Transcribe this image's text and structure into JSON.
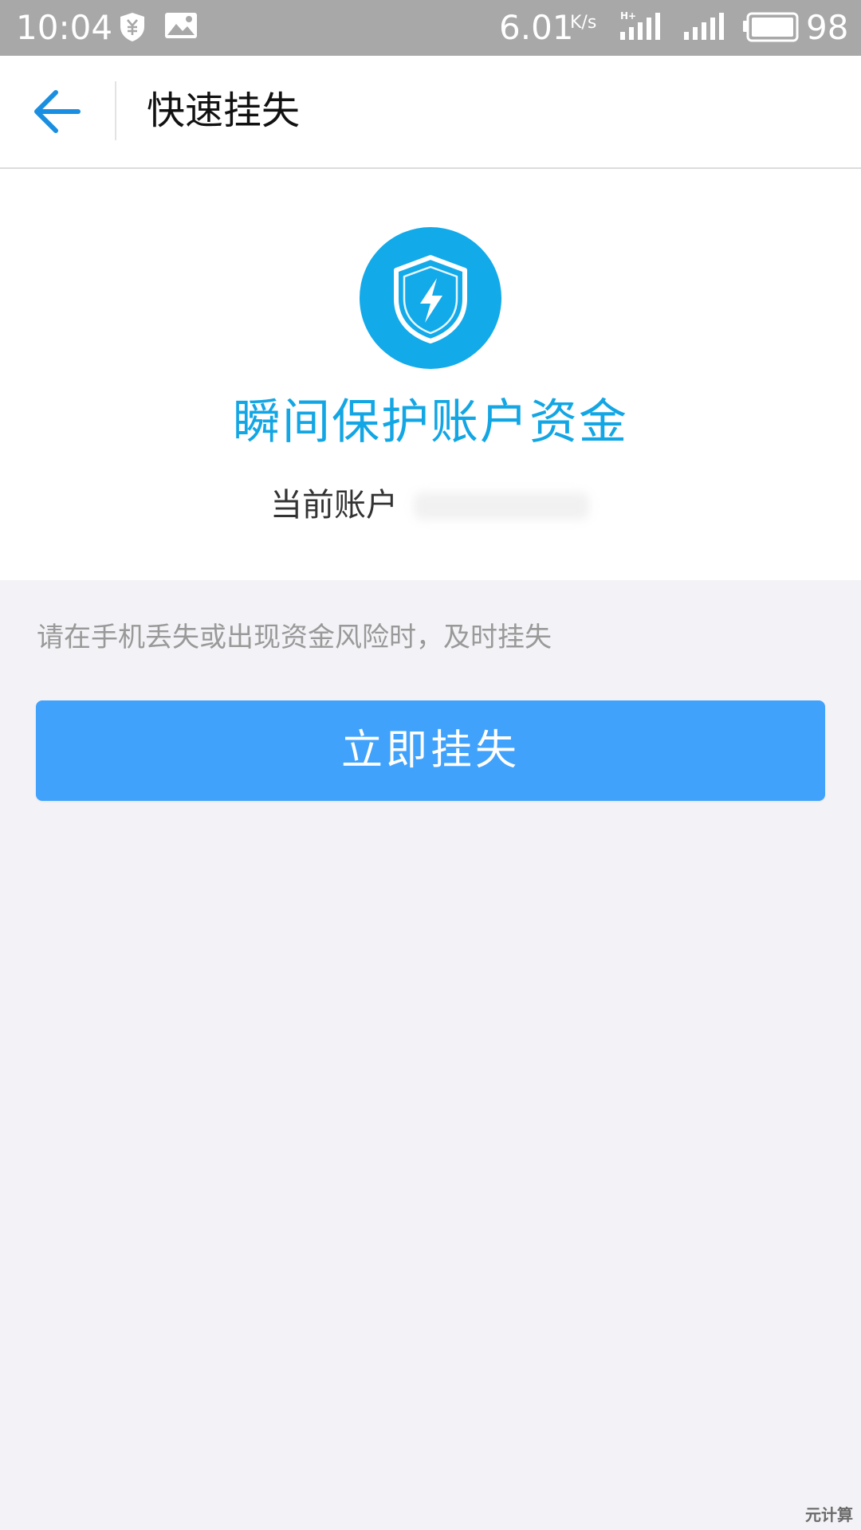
{
  "status_bar": {
    "time": "10:04",
    "network_speed": "6.01",
    "network_speed_unit": "K/s",
    "battery_level": "98",
    "icons": [
      "yuan-shield-icon",
      "image-icon",
      "hplus-signal-icon",
      "signal-icon",
      "battery-icon"
    ]
  },
  "header": {
    "title": "快速挂失",
    "back_icon": "arrow-left-icon"
  },
  "hero": {
    "icon": "shield-lightning-icon",
    "title": "瞬间保护账户资金",
    "account_label": "当前账户"
  },
  "hint": {
    "text": "请在手机丢失或出现资金风险时，及时挂失"
  },
  "actions": {
    "report_loss_label": "立即挂失"
  },
  "watermark": {
    "text": "元计算"
  },
  "colors": {
    "status_bar_bg": "#a8a8a8",
    "accent_blue": "#13a6e4",
    "button_blue": "#40a2fb",
    "page_bg": "#f3f3f7"
  }
}
